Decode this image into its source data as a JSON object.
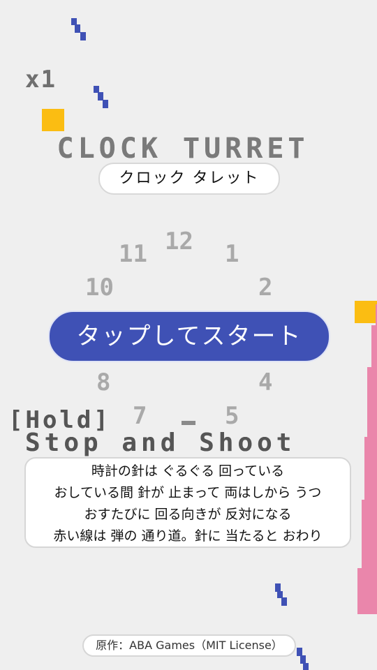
{
  "hud": {
    "multiplier": "x1"
  },
  "title": {
    "en": "CLOCK TURRET",
    "ja": "クロック タレット"
  },
  "clock": {
    "numbers": [
      "12",
      "1",
      "2",
      "4",
      "5",
      "7",
      "8",
      "10",
      "11"
    ]
  },
  "start_button": {
    "label": "タップしてスタート"
  },
  "controls": {
    "hold": "[Hold]",
    "action": "Stop and Shoot"
  },
  "instructions": {
    "lines": [
      "時計の針は ぐるぐる 回っている",
      "おしている間 針が 止まって 両はしから うつ",
      "おすたびに 回る向きが 反対になる",
      "赤い線は 弾の 通り道。針に 当たると おわり"
    ]
  },
  "credit": {
    "text": "原作：ABA Games（MIT License）"
  },
  "colors": {
    "background": "#efefef",
    "button": "#3f51b5",
    "coin": "#fbbd12",
    "bullet": "#3f51b5",
    "bar": "#ea86ab"
  }
}
